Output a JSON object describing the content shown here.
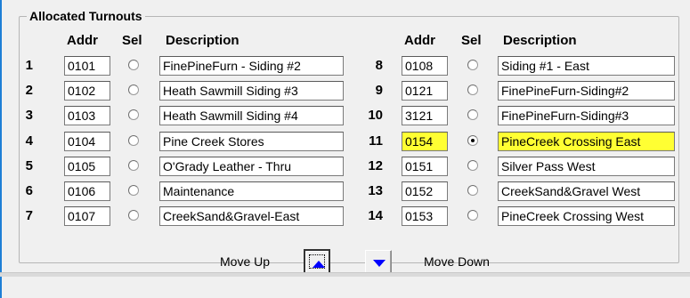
{
  "group": {
    "title": "Allocated Turnouts"
  },
  "headers": {
    "addr": "Addr",
    "sel": "Sel",
    "description": "Description"
  },
  "left_rows": [
    {
      "num": "1",
      "addr": "0101",
      "selected": false,
      "description": "FinePineFurn - Siding #2"
    },
    {
      "num": "2",
      "addr": "0102",
      "selected": false,
      "description": "Heath Sawmill Siding #3"
    },
    {
      "num": "3",
      "addr": "0103",
      "selected": false,
      "description": "Heath Sawmill Siding #4"
    },
    {
      "num": "4",
      "addr": "0104",
      "selected": false,
      "description": "Pine Creek Stores"
    },
    {
      "num": "5",
      "addr": "0105",
      "selected": false,
      "description": "O'Grady Leather - Thru"
    },
    {
      "num": "6",
      "addr": "0106",
      "selected": false,
      "description": "Maintenance"
    },
    {
      "num": "7",
      "addr": "0107",
      "selected": false,
      "description": "CreekSand&Gravel-East"
    }
  ],
  "right_rows": [
    {
      "num": "8",
      "addr": "0108",
      "selected": false,
      "description": "Siding #1 - East"
    },
    {
      "num": "9",
      "addr": "0121",
      "selected": false,
      "description": "FinePineFurn-Siding#2"
    },
    {
      "num": "10",
      "addr": "3121",
      "selected": false,
      "description": "FinePineFurn-Siding#3"
    },
    {
      "num": "11",
      "addr": "0154",
      "selected": true,
      "description": "PineCreek Crossing East"
    },
    {
      "num": "12",
      "addr": "0151",
      "selected": false,
      "description": "Silver Pass West"
    },
    {
      "num": "13",
      "addr": "0152",
      "selected": false,
      "description": "CreekSand&Gravel West"
    },
    {
      "num": "14",
      "addr": "0153",
      "selected": false,
      "description": "PineCreek Crossing West"
    }
  ],
  "controls": {
    "move_up_label": "Move Up",
    "move_down_label": "Move Down"
  },
  "colors": {
    "highlight": "#ffff33",
    "arrow": "#0000ff"
  },
  "icons": {
    "move_up": "up-arrow-icon",
    "move_down": "down-arrow-icon"
  }
}
